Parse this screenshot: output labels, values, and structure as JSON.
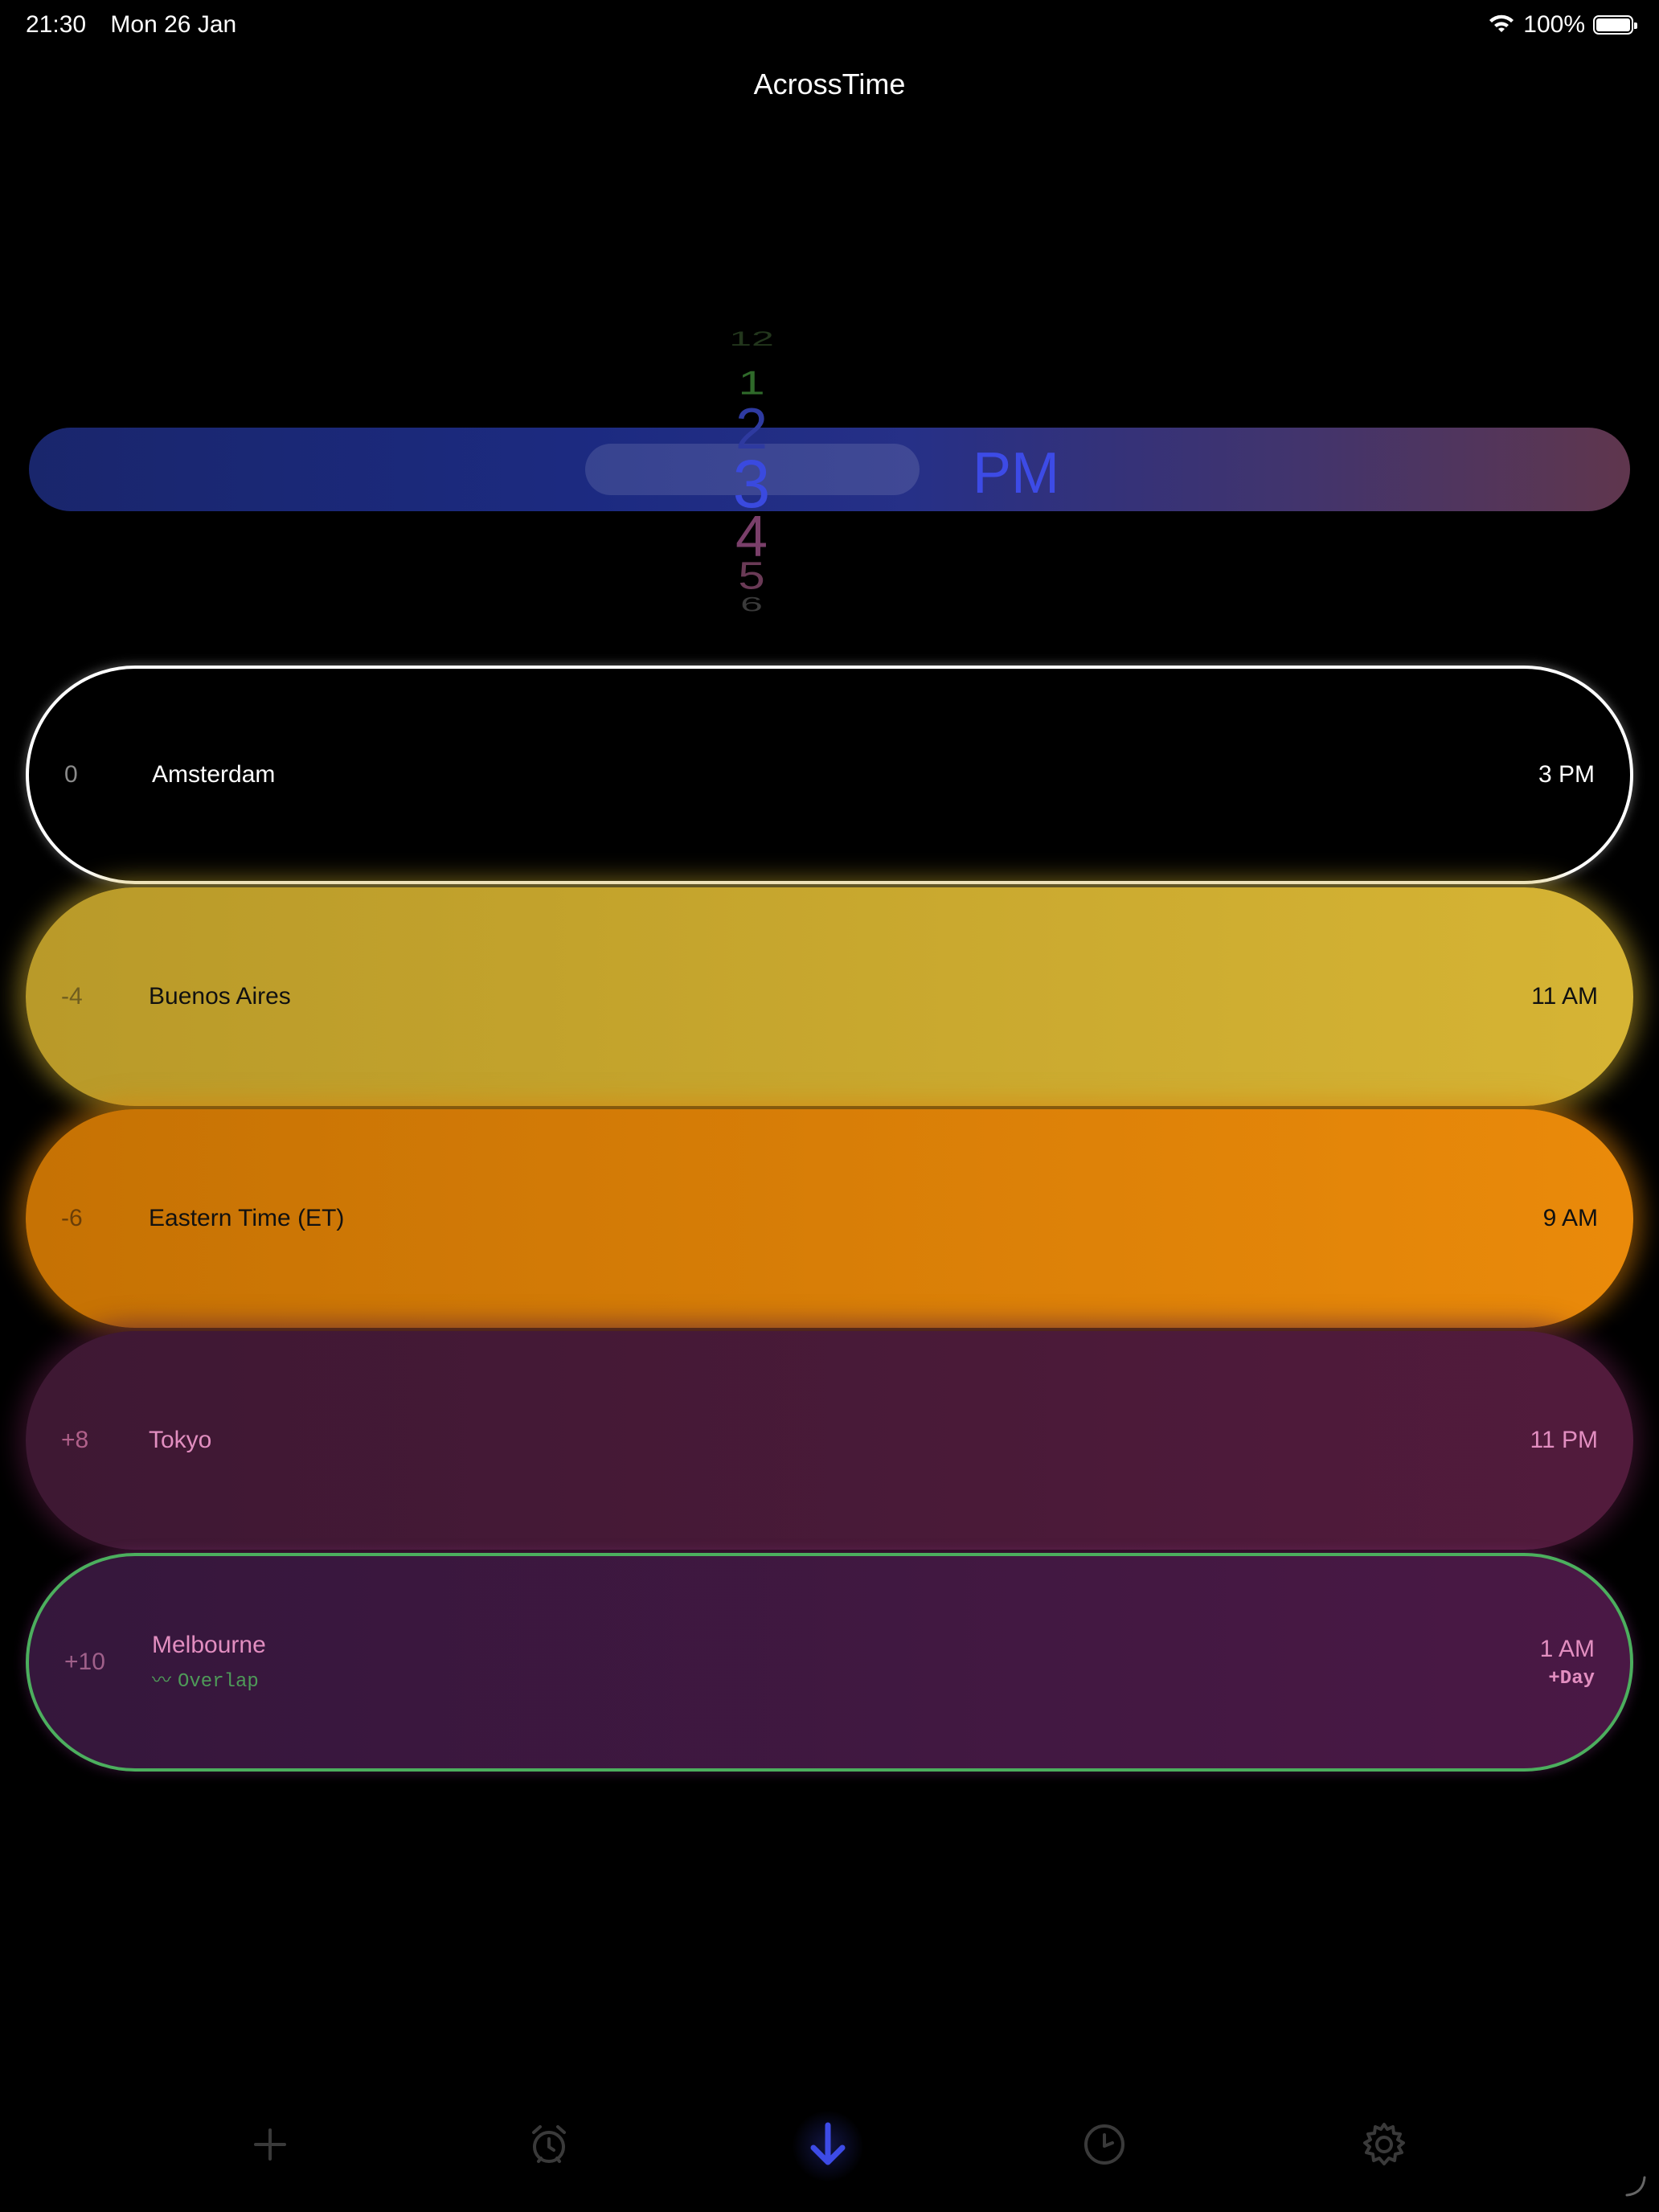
{
  "status_bar": {
    "time": "21:30",
    "date": "Mon 26 Jan",
    "battery": "100%",
    "battery_level": 1.0
  },
  "app": {
    "title": "AcrossTime"
  },
  "picker": {
    "hours": [
      "12",
      "1",
      "2",
      "3",
      "4",
      "5",
      "6"
    ],
    "selected_hour": "3",
    "period": "PM"
  },
  "rows": [
    {
      "offset": "0",
      "city": "Amsterdam",
      "time": "3 PM",
      "color": "#000000",
      "border": "#ffffff"
    },
    {
      "offset": "-4",
      "city": "Buenos Aires",
      "time": "11 AM",
      "color": "#c9aa35"
    },
    {
      "offset": "-6",
      "city": "Eastern Time (ET)",
      "time": "9 AM",
      "color": "#e08208"
    },
    {
      "offset": "+8",
      "city": "Tokyo",
      "time": "11 PM",
      "color": "#4a1a3a"
    },
    {
      "offset": "+10",
      "city": "Melbourne",
      "time": "1 AM",
      "sub_left": "Overlap",
      "sub_right": "+Day",
      "color": "#421843",
      "border": "#4caf5e"
    }
  ],
  "toolbar": {
    "icons": [
      "plus-icon",
      "alarm-icon",
      "arrow-down-icon",
      "clock-icon",
      "gear-icon"
    ],
    "accent": "#3d4be6"
  }
}
